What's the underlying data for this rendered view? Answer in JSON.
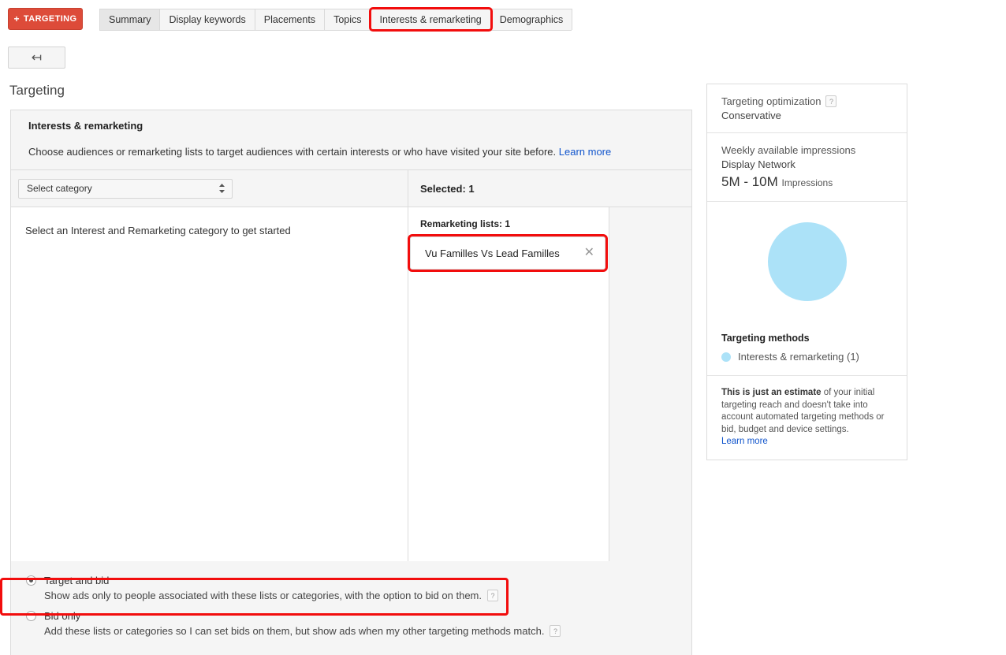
{
  "topbar": {
    "targeting_button": "TARGETING",
    "plus_icon": "plus-icon",
    "tabs": [
      {
        "label": "Summary",
        "state": "selected"
      },
      {
        "label": "Display keywords",
        "state": "normal"
      },
      {
        "label": "Placements",
        "state": "normal"
      },
      {
        "label": "Topics",
        "state": "normal"
      },
      {
        "label": "Interests & remarketing",
        "state": "highlighted"
      },
      {
        "label": "Demographics",
        "state": "normal"
      }
    ]
  },
  "back_button": {
    "icon": "back-arrow-icon",
    "glyph": "↤"
  },
  "page_title": "Targeting",
  "panel": {
    "heading": "Interests & remarketing",
    "description": "Choose audiences or remarketing lists to target audiences with certain interests or who have visited your site before.",
    "learn_more": "Learn more",
    "category_select": {
      "value": "Select category",
      "spinner_up": "▲",
      "spinner_down": "▼"
    },
    "selected_header": "Selected: 1",
    "empty_state": "Select an Interest and Remarketing category to get started",
    "remarketing_lists_label": "Remarketing lists: 1",
    "selected_items": [
      {
        "name": "Vu Familles Vs Lead Familles",
        "remove_icon": "✕"
      }
    ]
  },
  "bid_options": [
    {
      "label": "Target and bid",
      "description": "Show ads only to people associated with these lists or categories, with the option to bid on them.",
      "checked": true,
      "help": "?"
    },
    {
      "label": "Bid only",
      "description": "Add these lists or categories so I can set bids on them, but show ads when my other targeting methods match.",
      "checked": false,
      "help": "?"
    }
  ],
  "estimate": {
    "targeting_optimization_label": "Targeting optimization",
    "targeting_optimization_help": "?",
    "targeting_optimization_value": "Conservative",
    "impressions_label": "Weekly available impressions",
    "impressions_network": "Display Network",
    "impressions_value": "5M - 10M",
    "impressions_unit": "Impressions",
    "targeting_methods_title": "Targeting methods",
    "targeting_methods_item": "Interests & remarketing (1)",
    "disclaimer_bold": "This is just an estimate",
    "disclaimer_rest": " of your initial targeting reach and doesn't take into account automated targeting methods or bid, budget and device settings.",
    "disclaimer_link": "Learn more"
  },
  "colors": {
    "accent_red": "#dd4b39",
    "highlight_red": "#f20d0d",
    "chart_blue": "#ace2f8",
    "link_blue": "#1155cc",
    "panel_bg": "#f5f5f5"
  }
}
